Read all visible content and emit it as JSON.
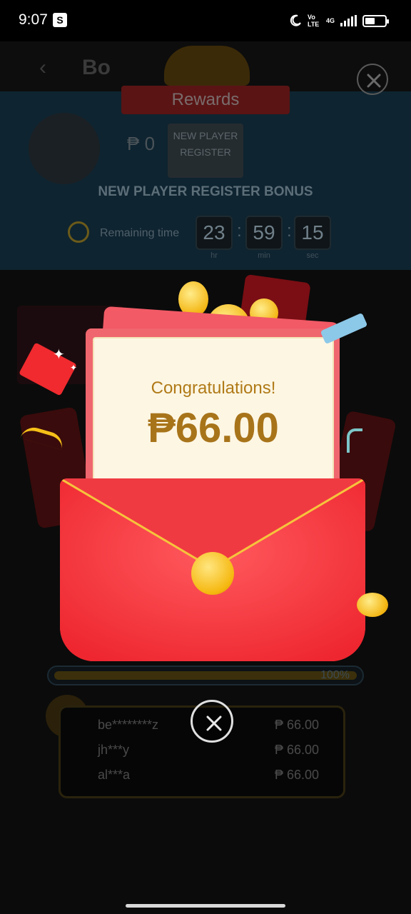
{
  "status_bar": {
    "time": "9:07",
    "s_badge": "S",
    "network_top": "4G",
    "volte": "Vo LTE",
    "battery_percent": 50
  },
  "background_page": {
    "back_glyph": "‹",
    "title": "Bo",
    "rewards_ribbon": "Rewards",
    "balance_prefix": "₱ 0",
    "chip_label": "NEW PLAYER REGISTER",
    "bonus_title": "NEW PLAYER REGISTER BONUS",
    "remaining_label": "Remaining time",
    "timer": {
      "hours": "23",
      "minutes": "59",
      "seconds": "15",
      "hr": "hr",
      "min": "min",
      "sec": "sec"
    },
    "progress_label": "100%",
    "progress_value": 1.0,
    "leaderboard": [
      {
        "name": "be********z",
        "amount": "₱ 66.00"
      },
      {
        "name": "jh***y",
        "amount": "₱ 66.00"
      },
      {
        "name": "al***a",
        "amount": "₱ 66.00"
      }
    ]
  },
  "reward_popup": {
    "congrats_text": "Congratulations!",
    "amount": "₱66.00"
  },
  "icons": {
    "top_close": "close-icon",
    "modal_close": "close-icon",
    "timer": "stopwatch-icon",
    "seal": "coin-seal-icon"
  },
  "colors": {
    "envelope_red": "#f12d36",
    "letter_bg": "#fdf6e3",
    "amount_gold": "#a8741a",
    "coin_gold": "#f5b70e"
  }
}
